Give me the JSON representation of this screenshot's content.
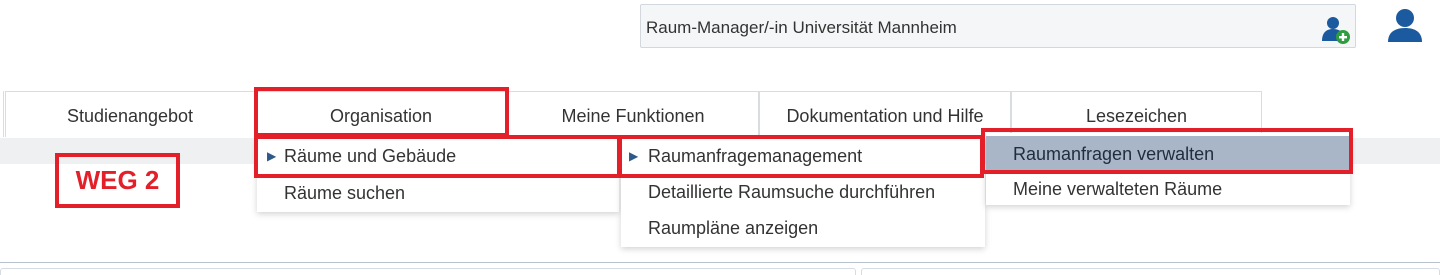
{
  "role_selector": {
    "value": "Raum-Manager/-in Universität Mannheim",
    "add_icon": "user-plus-icon",
    "user_icon": "user-icon"
  },
  "nav": {
    "tabs": [
      "Studienangebot",
      "Organisation",
      "Meine Funktionen",
      "Dokumentation und Hilfe",
      "Lesezeichen"
    ]
  },
  "menu_organisation": {
    "items": [
      "Räume und Gebäude",
      "Räume suchen"
    ]
  },
  "menu_raeume": {
    "items": [
      "Raumanfragemanagement",
      "Detaillierte Raumsuche durchführen",
      "Raumpläne anzeigen"
    ]
  },
  "menu_raumanfrage": {
    "items": [
      "Raumanfragen verwalten",
      "Meine verwalteten Räume"
    ]
  },
  "annotation": {
    "label": "WEG 2"
  },
  "colors": {
    "annotation_red": "#e3202a",
    "highlight": "#a8b6c7",
    "link_blue": "#2f5a88"
  }
}
